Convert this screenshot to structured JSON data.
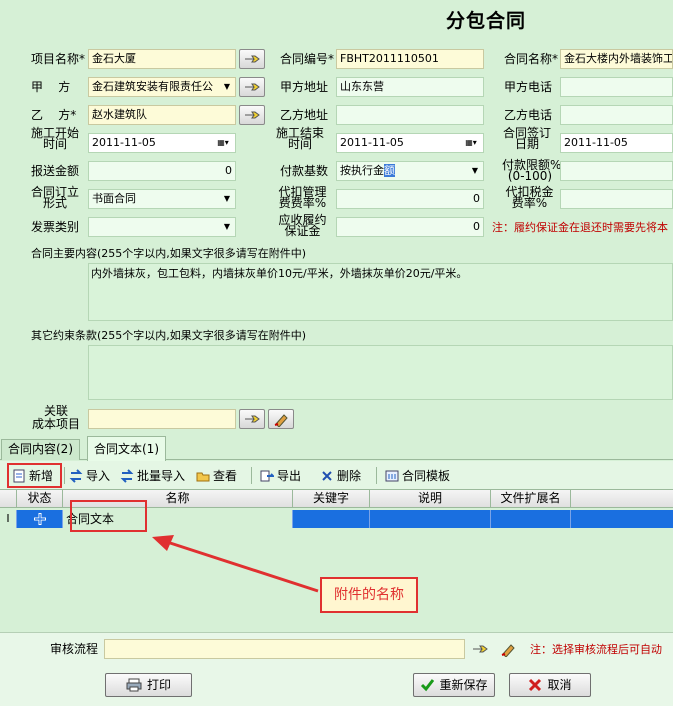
{
  "title": "分包合同",
  "fields": {
    "project_name": {
      "label": "项目名称*",
      "value": "金石大厦"
    },
    "contract_no": {
      "label": "合同编号*",
      "value": "FBHT2011110501"
    },
    "contract_name": {
      "label": "合同名称*",
      "value": "金石大楼内外墙装饰工"
    },
    "party_a": {
      "label": "甲    方",
      "value": "金石建筑安装有限责任公"
    },
    "party_a_addr": {
      "label": "甲方地址",
      "value": "山东东营"
    },
    "party_a_phone": {
      "label": "甲方电话",
      "value": ""
    },
    "party_b": {
      "label": "乙    方*",
      "value": "赵水建筑队"
    },
    "party_b_addr": {
      "label": "乙方地址",
      "value": ""
    },
    "party_b_phone": {
      "label": "乙方电话",
      "value": ""
    },
    "start_date": {
      "label_l1": "施工开始",
      "label_l2": "时间",
      "value": "2011-11-05"
    },
    "end_date": {
      "label_l1": "施工结束",
      "label_l2": "时间",
      "value": "2011-11-05"
    },
    "sign_date": {
      "label_l1": "合同签订",
      "label_l2": "日期",
      "value": "2011-11-05"
    },
    "report_amount": {
      "label": "报送金额",
      "value": "0"
    },
    "payment_base": {
      "label": "付款基数",
      "value_part1": "按执行金",
      "value_part2": "额"
    },
    "payment_limit": {
      "label_l1": "付款限额%",
      "label_l2": "(0-100)",
      "value": ""
    },
    "contract_form": {
      "label_l1": "合同订立",
      "label_l2": "形式",
      "value": "书面合同"
    },
    "mgmt_fee_rate": {
      "label_l1": "代扣管理",
      "label_l2": "费费率%",
      "value": "0"
    },
    "tax_rate": {
      "label_l1": "代扣税金",
      "label_l2": "费率%",
      "value": ""
    },
    "invoice_type": {
      "label": "发票类别",
      "value": ""
    },
    "deposit": {
      "label_l1": "应收履约",
      "label_l2": "保证金",
      "value": "0"
    },
    "deposit_note": "注：履约保证金在退还时需要先将本",
    "main_content": {
      "label": "合同主要内容(255个字以内,如果文字很多请写在附件中)",
      "value": "内外墙抹灰，包工包料，内墙抹灰单价10元/平米，外墙抹灰单价20元/平米。"
    },
    "other_terms": {
      "label": "其它约束条款(255个字以内,如果文字很多请写在附件中)",
      "value": ""
    },
    "cost_item": {
      "label_l1": "关联",
      "label_l2": "成本项目",
      "value": ""
    }
  },
  "tabs": [
    {
      "label": "合同内容(2)"
    },
    {
      "label": "合同文本(1)"
    }
  ],
  "toolbar": {
    "new": "新增",
    "import": "导入",
    "batch_import": "批量导入",
    "view": "查看",
    "export": "导出",
    "delete": "删除",
    "template": "合同模板"
  },
  "grid": {
    "headers": [
      "状态",
      "名称",
      "关键字",
      "说明",
      "文件扩展名"
    ],
    "rows": [
      {
        "indicator": "I",
        "name": "合同文本"
      }
    ]
  },
  "annotation": "附件的名称",
  "workflow": {
    "label": "审核流程",
    "value": "",
    "note": "注：选择审核流程后可自动"
  },
  "buttons": {
    "print": "打印",
    "resave": "重新保存",
    "cancel": "取消"
  },
  "colors": {
    "background": "#d6f0d6",
    "selection": "#1a6fe0",
    "annotation": "#e03030",
    "note": "#c00000"
  }
}
